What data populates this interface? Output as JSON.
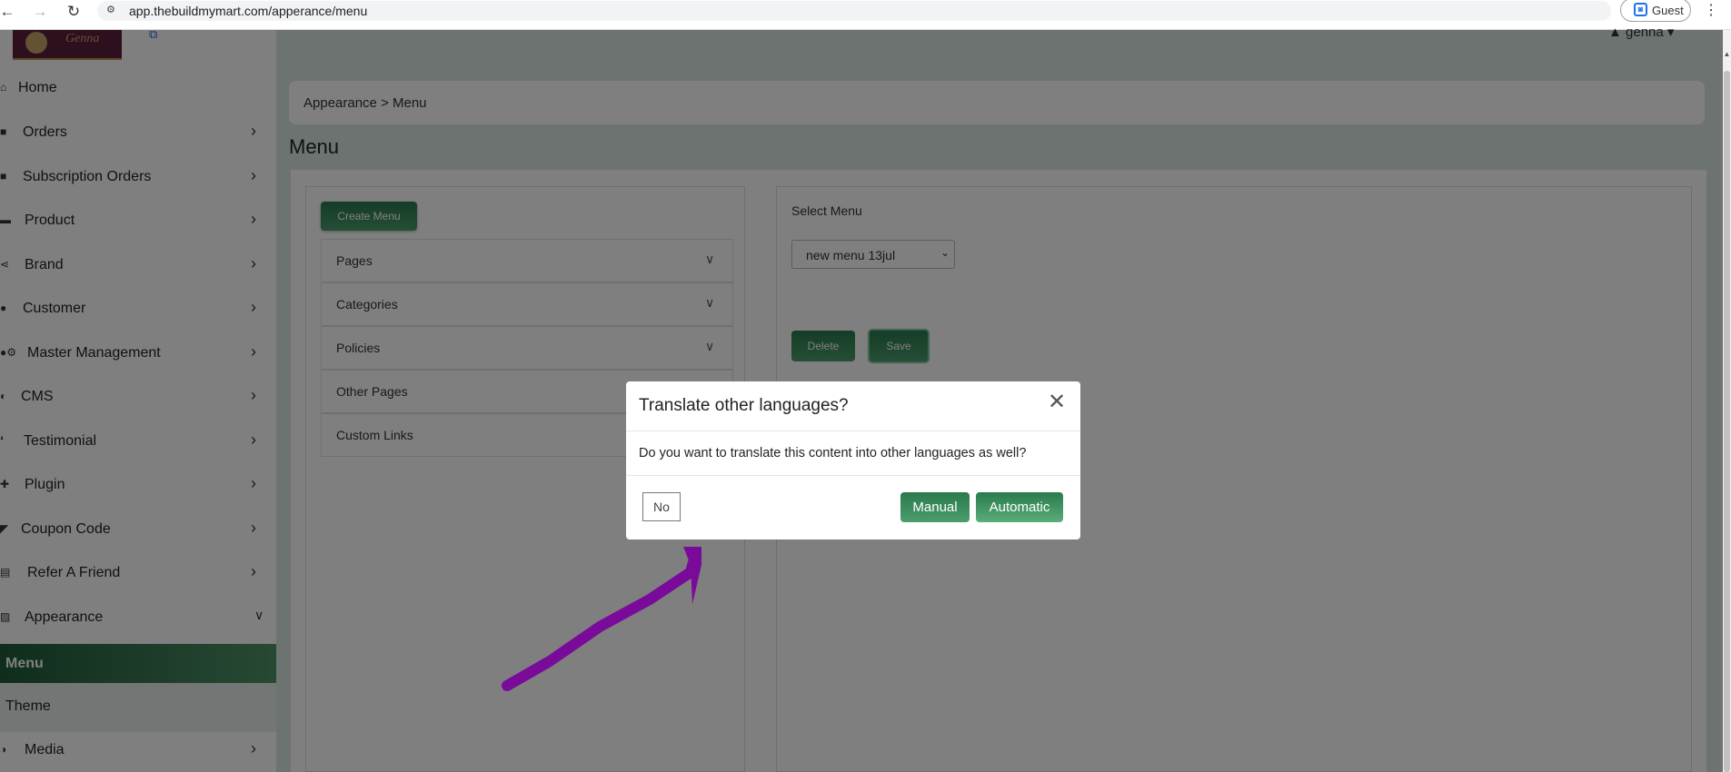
{
  "browser": {
    "back_icon": "back-arrow-icon",
    "forward_icon": "forward-arrow-icon",
    "reload_icon": "reload-icon",
    "url": "app.thebuildmymart.com/apperance/menu",
    "profile_label": "Guest"
  },
  "header": {
    "user_name": "genna"
  },
  "sidebar": {
    "items": [
      {
        "label": "Home",
        "icon": "home-icon"
      },
      {
        "label": "Orders",
        "icon": "bag-icon"
      },
      {
        "label": "Subscription Orders",
        "icon": "bag-icon"
      },
      {
        "label": "Product",
        "icon": "box-icon"
      },
      {
        "label": "Brand",
        "icon": "share-icon"
      },
      {
        "label": "Customer",
        "icon": "user-icon"
      },
      {
        "label": "Master Management",
        "icon": "users-gear-icon"
      },
      {
        "label": "CMS",
        "icon": "cms-icon"
      },
      {
        "label": "Testimonial",
        "icon": "quote-icon"
      },
      {
        "label": "Plugin",
        "icon": "puzzle-icon"
      },
      {
        "label": "Coupon Code",
        "icon": "tag-icon"
      },
      {
        "label": "Refer A Friend",
        "icon": "card-icon"
      },
      {
        "label": "Appearance",
        "icon": "image-icon"
      },
      {
        "label": "Menu"
      },
      {
        "label": "Theme"
      },
      {
        "label": "Media",
        "icon": "media-icon"
      }
    ]
  },
  "breadcrumb": "Appearance > Menu",
  "page_title": "Menu",
  "left_panel": {
    "create_button": "Create Menu",
    "accordions": [
      {
        "label": "Pages",
        "has_chevron": true
      },
      {
        "label": "Categories",
        "has_chevron": true
      },
      {
        "label": "Policies",
        "has_chevron": true
      },
      {
        "label": "Other Pages",
        "has_chevron": false
      },
      {
        "label": "Custom Links",
        "has_chevron": false
      }
    ]
  },
  "right_panel": {
    "select_label": "Select Menu",
    "selected_menu": "new menu 13jul",
    "delete_button": "Delete",
    "save_button": "Save"
  },
  "modal": {
    "title": "Translate other languages?",
    "body": "Do you want to translate this content into other languages as well?",
    "no_button": "No",
    "manual_button": "Manual",
    "automatic_button": "Automatic"
  },
  "annotation": {
    "color": "#7a0a9a"
  }
}
